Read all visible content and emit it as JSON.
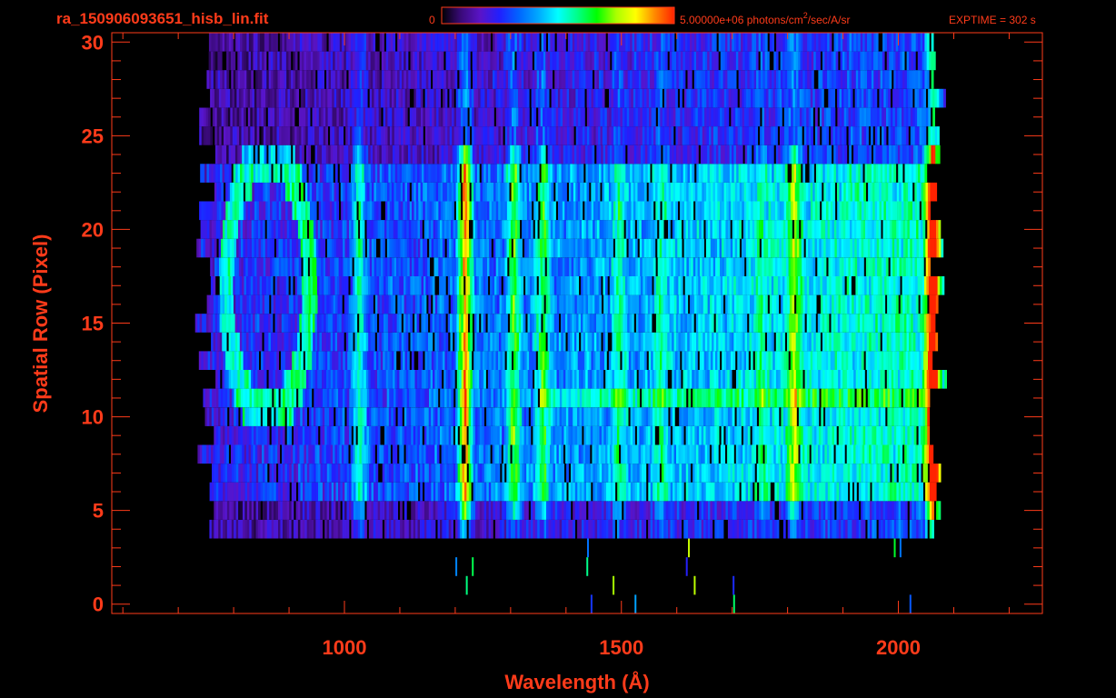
{
  "file_title": "ra_150906093651_hisb_lin.fit",
  "colorbar": {
    "min_label": "0",
    "max_label": "5.00000e+06 photons/cm",
    "unit_sup": "2",
    "unit_tail": "/sec/A/sr",
    "colors": [
      "#000000",
      "#3a0a7a",
      "#5a14c8",
      "#2020ff",
      "#0066ff",
      "#00aaff",
      "#00ffff",
      "#00ff88",
      "#00ff00",
      "#aaff00",
      "#ffff00",
      "#ff8800",
      "#ff2200"
    ]
  },
  "exptime": "EXPTIME = 302 s",
  "colors": {
    "axis": "#ff3b1a",
    "background": "#000000"
  },
  "chart_data": {
    "type": "heatmap",
    "xlabel": "Wavelength (Å)",
    "ylabel": "Spatial Row (Pixel)",
    "xlim": [
      580,
      2260
    ],
    "ylim": [
      -0.5,
      30.5
    ],
    "xticks": [
      1000,
      1500,
      2000
    ],
    "xtick_labels": [
      "1000",
      "1500",
      "2000"
    ],
    "yticks": [
      0,
      5,
      10,
      15,
      20,
      25,
      30
    ],
    "ytick_labels": [
      "0",
      "5",
      "10",
      "15",
      "20",
      "25",
      "30"
    ],
    "x_minor_step": 100,
    "y_minor_step": 1,
    "value_range": [
      0,
      5000000
    ],
    "data_x_range": [
      750,
      2070
    ],
    "data_rows": [
      4,
      30
    ],
    "emission_lines_A": [
      1025,
      1216,
      1304,
      1356,
      1493,
      1570,
      1750,
      1810,
      2060
    ],
    "ring_feature": {
      "center_A": 860,
      "row_range": [
        10,
        24
      ]
    }
  }
}
